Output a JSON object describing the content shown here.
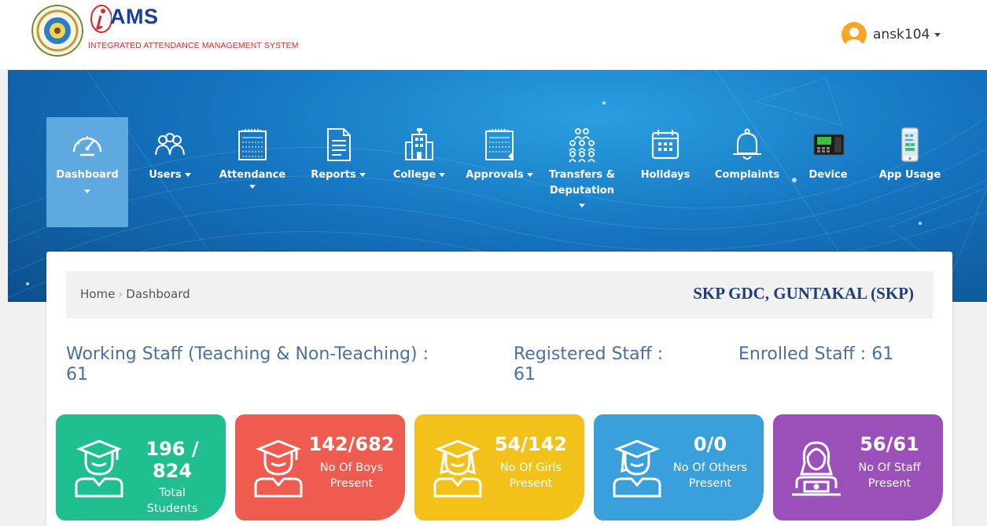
{
  "header": {
    "brand_name": "AMS",
    "brand_subtitle": "INTEGRATED ATTENDANCE MANAGEMENT SYSTEM",
    "username": "ansk104"
  },
  "nav": {
    "items": [
      {
        "label": "Dashboard",
        "icon": "speedometer-icon",
        "active": true
      },
      {
        "label": "Users",
        "icon": "users-icon"
      },
      {
        "label": "Attendance",
        "icon": "calendar-notebook-icon"
      },
      {
        "label": "Reports",
        "icon": "document-icon"
      },
      {
        "label": "College",
        "icon": "building-icon"
      },
      {
        "label": "Approvals",
        "icon": "notebook-icon"
      },
      {
        "label_line1": "Transfers &",
        "label_line2": "Deputation",
        "icon": "people-group-icon"
      },
      {
        "label": "Holidays",
        "icon": "calendar-icon"
      },
      {
        "label": "Complaints",
        "icon": "bell-icon"
      },
      {
        "label": "Device",
        "icon": "biometric-device-icon"
      },
      {
        "label": "App Usage",
        "icon": "mobile-phone-icon"
      }
    ]
  },
  "breadcrumb": {
    "home": "Home",
    "current": "Dashboard"
  },
  "college_name": "SKP GDC, GUNTAKAL (SKP)",
  "stats": {
    "working_label": "Working Staff (Teaching & Non-Teaching) :",
    "working_value": "61",
    "registered_label": "Registered Staff :",
    "registered_value": "61",
    "enrolled_label": "Enrolled Staff : 61"
  },
  "tiles": [
    {
      "line1": "196 /",
      "line2": "824",
      "desc1": "Total",
      "desc2": "Students",
      "color": "#1fbf8f"
    },
    {
      "line1": "142/682",
      "desc1": "No Of Boys",
      "desc2": "Present",
      "color": "#ef5b4f"
    },
    {
      "line1": "54/142",
      "desc1": "No Of Girls",
      "desc2": "Present",
      "color": "#f2c21a"
    },
    {
      "line1": "0/0",
      "desc1": "No Of Others",
      "desc2": "Present",
      "color": "#3aa0dc"
    },
    {
      "line1": "56/61",
      "desc1": "No Of Staff",
      "desc2": "Present",
      "color": "#9b4fb8"
    }
  ]
}
